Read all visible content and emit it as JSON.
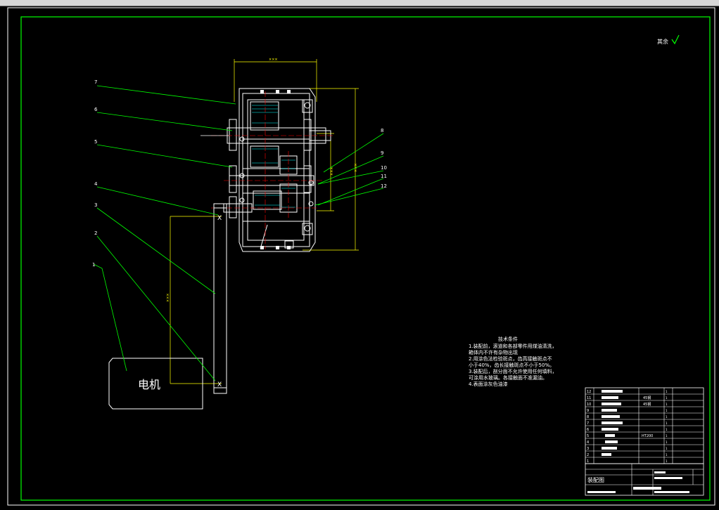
{
  "drawing": {
    "surface_roughness_note": "其余",
    "motor_label": "电机",
    "part_numbers": [
      "1",
      "2",
      "3",
      "4",
      "5",
      "6",
      "7",
      "8",
      "9",
      "10",
      "11",
      "12"
    ],
    "tech_requirements": {
      "title": "技术条件",
      "lines": [
        "1.装配前，滚道和各部零件用煤油清洗，",
        "箱体内不许有杂物出现",
        "2.用涂色法检验斑点，齿高接触斑点不",
        "小于40%，齿长接触斑点不小于50%。",
        "3.装配后，剖分面不允许使用任何填料，",
        "可涂用水玻璃。各接触面不准漏油。",
        "4.表面涂灰色油漆"
      ]
    },
    "parts_list_rows": [
      "12",
      "11",
      "10",
      "9",
      "8",
      "7",
      "6",
      "5",
      "4",
      "3",
      "2",
      "1"
    ],
    "material_labels": [
      "45钢",
      "45钢",
      "HT200"
    ],
    "title_block": {
      "drawing_name": "装配图"
    },
    "colors": {
      "background": "#000000",
      "outline": "#ffffff",
      "border": "#00ff00",
      "center_line": "#ff0000",
      "dimension": "#ffff00",
      "hatch": "#00ffff",
      "leader": "#00ff00"
    }
  }
}
